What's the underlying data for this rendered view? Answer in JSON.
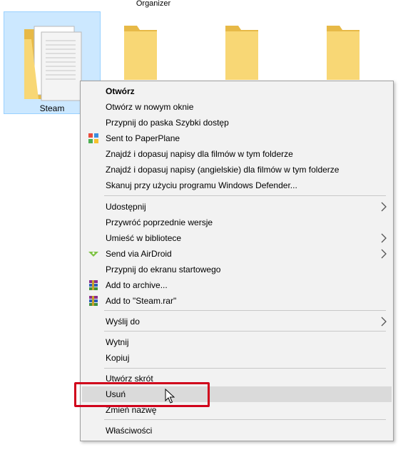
{
  "folders": {
    "top_label": "Organizer",
    "selected_label": "Steam"
  },
  "menu": {
    "items": [
      {
        "label": "Otwórz",
        "bold": true
      },
      {
        "label": "Otwórz w nowym oknie"
      },
      {
        "label": "Przypnij do paska Szybki dostęp"
      },
      {
        "label": "Sent to PaperPlane",
        "icon": "paperplane-icon"
      },
      {
        "label": "Znajdź i dopasuj napisy dla filmów w tym folderze"
      },
      {
        "label": "Znajdź i dopasuj napisy (angielskie) dla filmów w tym folderze"
      },
      {
        "label": "Skanuj przy użyciu programu Windows Defender..."
      },
      {
        "label": "Udostępnij",
        "submenu": true
      },
      {
        "label": "Przywróć poprzednie wersje"
      },
      {
        "label": "Umieść w bibliotece",
        "submenu": true
      },
      {
        "label": "Send via AirDroid",
        "icon": "airdroid-icon",
        "submenu": true
      },
      {
        "label": "Przypnij do ekranu startowego"
      },
      {
        "label": "Add to archive...",
        "icon": "winrar-icon"
      },
      {
        "label": "Add to \"Steam.rar\"",
        "icon": "winrar-icon"
      },
      {
        "label": "Wyślij do",
        "submenu": true
      },
      {
        "label": "Wytnij"
      },
      {
        "label": "Kopiuj"
      },
      {
        "label": "Utwórz skrót"
      },
      {
        "label": "Usuń",
        "highlighted": true
      },
      {
        "label": "Zmień nazwę"
      },
      {
        "label": "Właściwości"
      }
    ]
  },
  "colors": {
    "highlight_box": "#d0021b",
    "selection": "#cce8ff",
    "folder": "#f8d775"
  }
}
